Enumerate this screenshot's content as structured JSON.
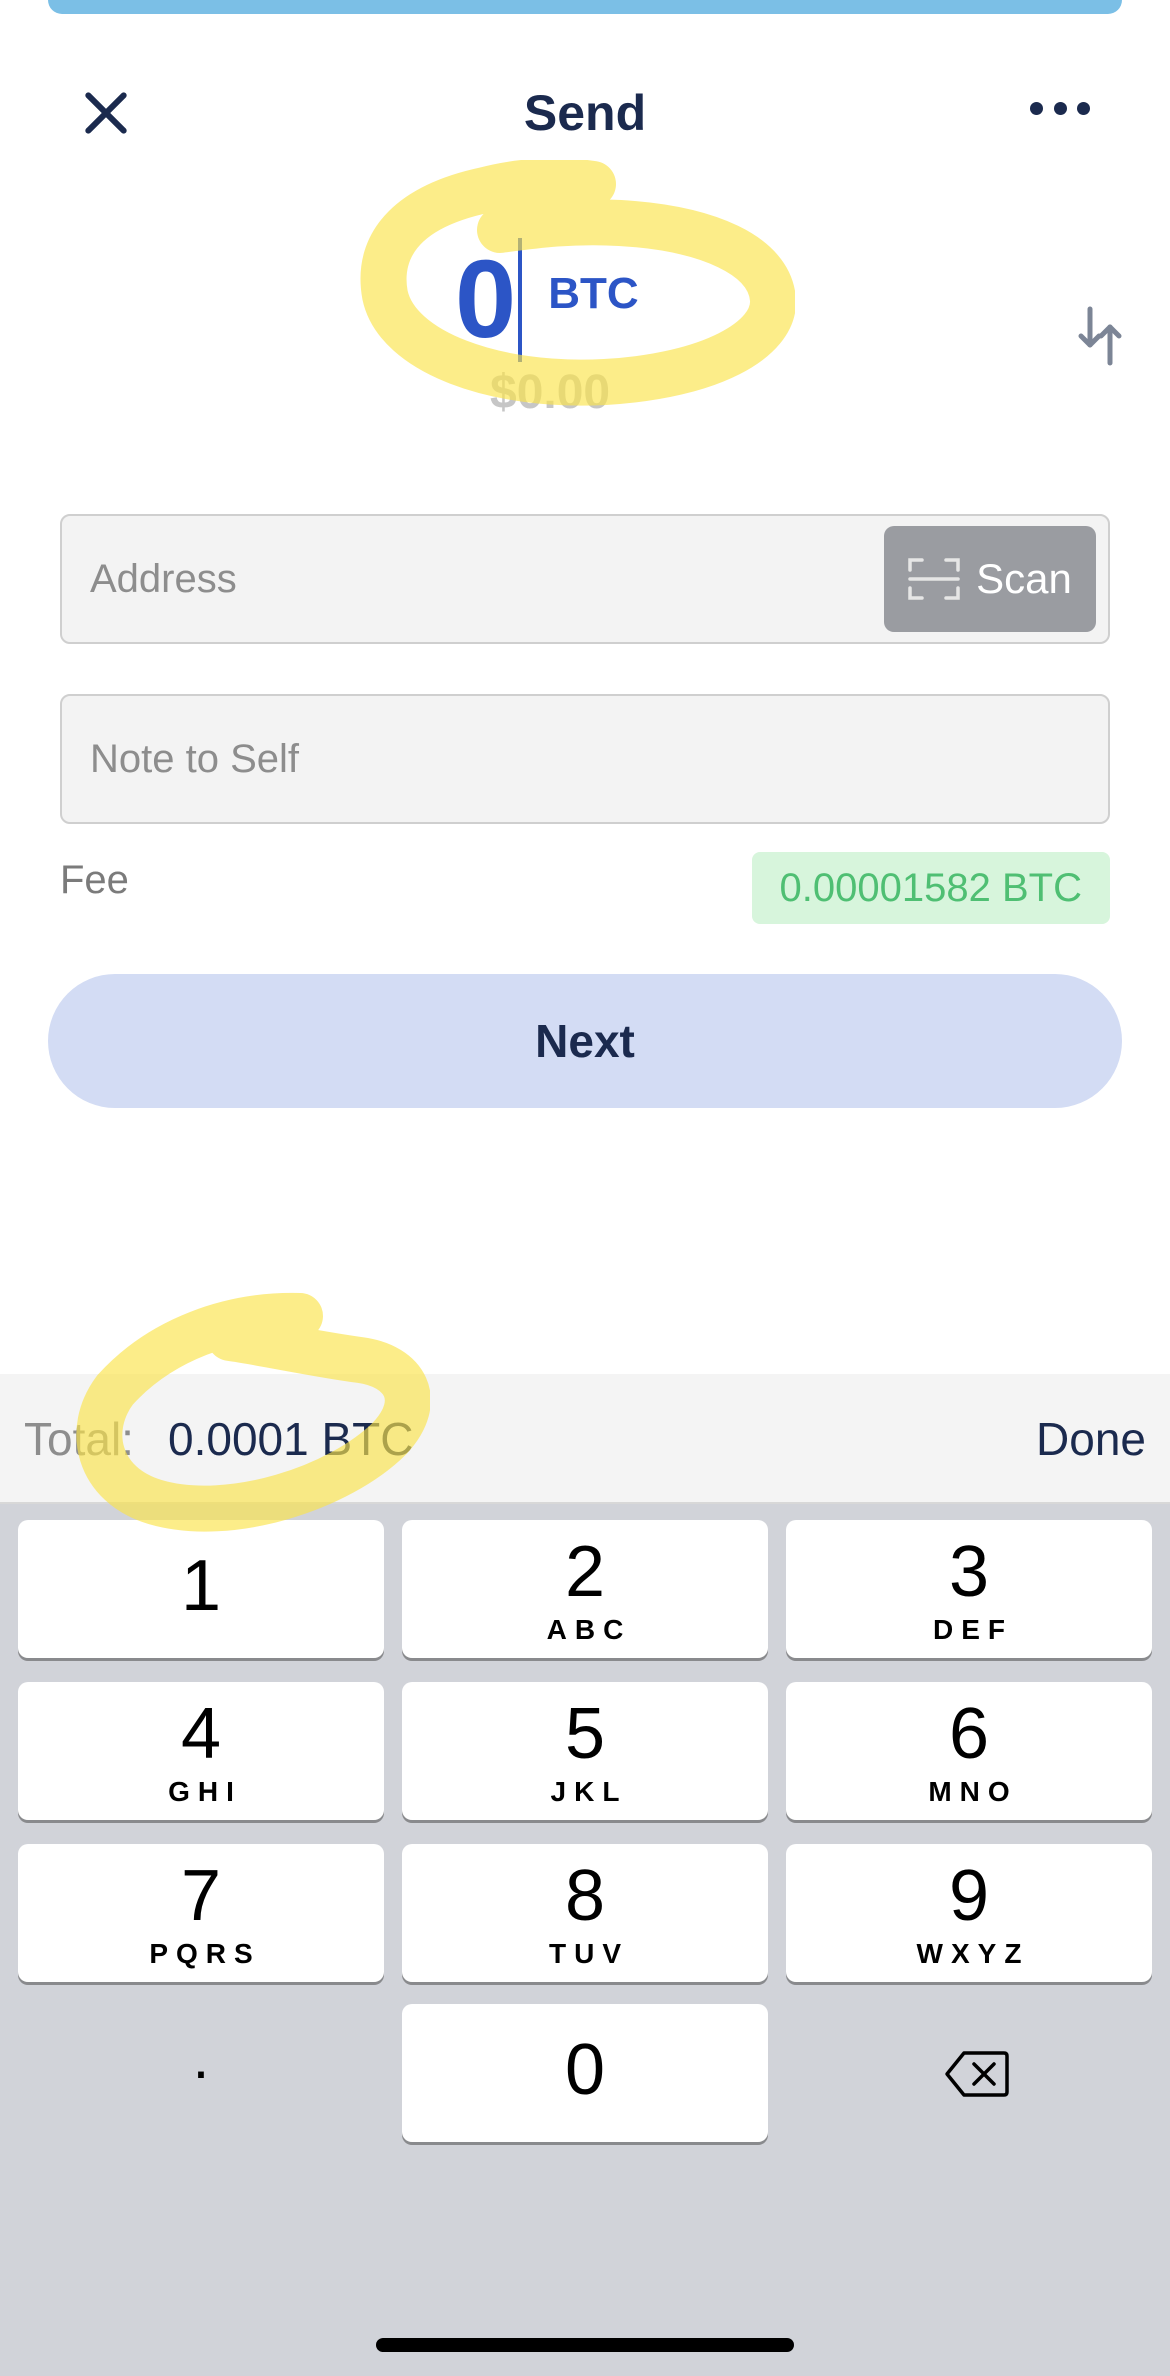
{
  "header": {
    "title": "Send"
  },
  "amount": {
    "value": "0",
    "unit": "BTC",
    "fiat": "$0.00"
  },
  "address_field": {
    "placeholder": "Address",
    "scan_label": "Scan"
  },
  "note_field": {
    "placeholder": "Note to Self"
  },
  "fee": {
    "label": "Fee",
    "value": "0.00001582 BTC"
  },
  "next_label": "Next",
  "total_bar": {
    "label": "Total:",
    "value": "0.0001 BTC",
    "done_label": "Done"
  },
  "keypad": {
    "keys": [
      {
        "digit": "1",
        "letters": ""
      },
      {
        "digit": "2",
        "letters": "ABC"
      },
      {
        "digit": "3",
        "letters": "DEF"
      },
      {
        "digit": "4",
        "letters": "GHI"
      },
      {
        "digit": "5",
        "letters": "JKL"
      },
      {
        "digit": "6",
        "letters": "MNO"
      },
      {
        "digit": "7",
        "letters": "PQRS"
      },
      {
        "digit": "8",
        "letters": "TUV"
      },
      {
        "digit": "9",
        "letters": "WXYZ"
      },
      {
        "digit": "0",
        "letters": ""
      }
    ],
    "decimal": "."
  },
  "colors": {
    "accent_blue": "#2c55c6",
    "navy_text": "#1b2a4e",
    "next_button_bg": "#d3dcf4",
    "fee_green_text": "#4fbf73",
    "fee_green_bg": "#d7f5dc",
    "highlighter_yellow": "#fbe34a",
    "keyboard_bg": "#d1d3d9"
  },
  "icons": {
    "close": "close-icon",
    "more": "more-icon",
    "swap": "swap-arrows-icon",
    "scan": "scan-frame-icon",
    "backspace": "backspace-icon"
  }
}
